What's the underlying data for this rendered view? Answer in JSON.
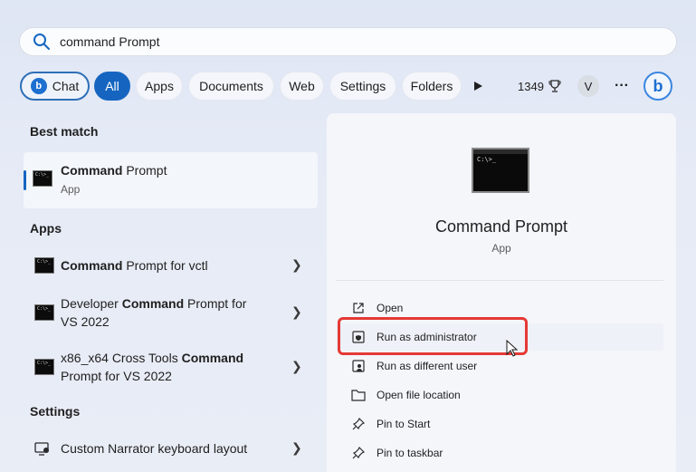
{
  "search": {
    "query_typed": "command",
    "query_suggest": " Prompt"
  },
  "filters": {
    "chat": "Chat",
    "tabs": [
      "All",
      "Apps",
      "Documents",
      "Web",
      "Settings",
      "Folders"
    ],
    "active": "All",
    "points": "1349",
    "avatar_initial": "V",
    "more": "···"
  },
  "left": {
    "best_match_title": "Best match",
    "best_match": {
      "bold": "Command",
      "rest": " Prompt",
      "type": "App"
    },
    "apps_title": "Apps",
    "apps": [
      {
        "line1_pre": "",
        "line1_bold": "Command",
        "line1_post": " Prompt for vctl",
        "line2": ""
      },
      {
        "line1_pre": "Developer ",
        "line1_bold": "Command",
        "line1_post": " Prompt for",
        "line2": "VS 2022"
      },
      {
        "line1_pre": "x86_x64 Cross Tools ",
        "line1_bold": "Command",
        "line1_post": "",
        "line2": "Prompt for VS 2022"
      }
    ],
    "settings_title": "Settings",
    "settings": [
      {
        "label": "Custom Narrator keyboard layout"
      }
    ]
  },
  "right": {
    "title": "Command Prompt",
    "subtitle": "App",
    "actions": [
      {
        "label": "Open",
        "icon": "open-external-icon"
      },
      {
        "label": "Run as administrator",
        "icon": "shield-icon"
      },
      {
        "label": "Run as different user",
        "icon": "user-icon"
      },
      {
        "label": "Open file location",
        "icon": "folder-icon"
      },
      {
        "label": "Pin to Start",
        "icon": "pin-icon"
      },
      {
        "label": "Pin to taskbar",
        "icon": "pin-icon"
      }
    ]
  },
  "colors": {
    "accent": "#1565c0",
    "highlight": "#e53935"
  }
}
